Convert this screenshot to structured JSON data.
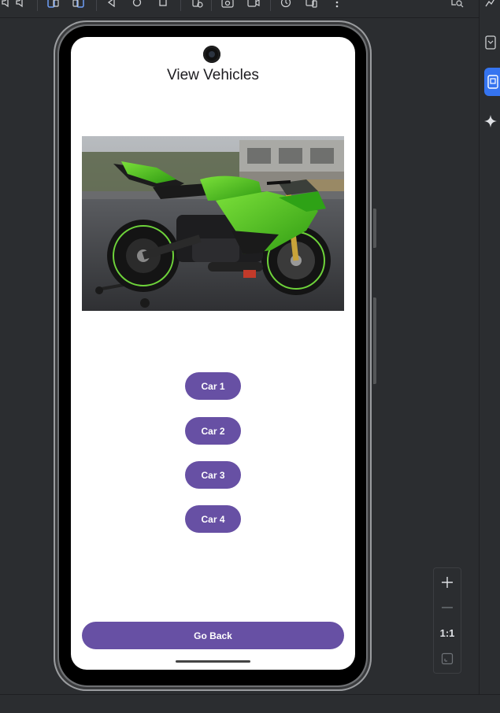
{
  "ide": {
    "toolbar_icons": [
      "volume-down-icon",
      "volume-up-icon",
      "rotate-left-icon",
      "rotate-right-icon",
      "back-icon",
      "home-icon",
      "overview-icon",
      "settings-icon",
      "screenshot-icon",
      "screen-record-icon",
      "snapshot-icon",
      "device-mirror-icon",
      "more-icon",
      "inspect-icon"
    ],
    "right_strip_icons": [
      "notifications-icon",
      "device-manager-icon",
      "running-devices-icon",
      "gemini-icon"
    ],
    "zoom": {
      "zoom_in_icon": "plus-icon",
      "zoom_out_icon": "minus-icon",
      "actual_size_label": "1:1",
      "fit_icon": "fit-screen-icon"
    }
  },
  "app": {
    "title": "View Vehicles",
    "hero_image": "green sport motorcycle on paddock stand",
    "car_buttons": [
      "Car 1",
      "Car 2",
      "Car 3",
      "Car 4"
    ],
    "back_button": "Go Back"
  },
  "colors": {
    "ide_background": "#2b2d30",
    "button_primary": "#6750a4",
    "button_text": "#ffffff",
    "screen_background": "#ffffff",
    "active_tool": "#3574f0"
  }
}
